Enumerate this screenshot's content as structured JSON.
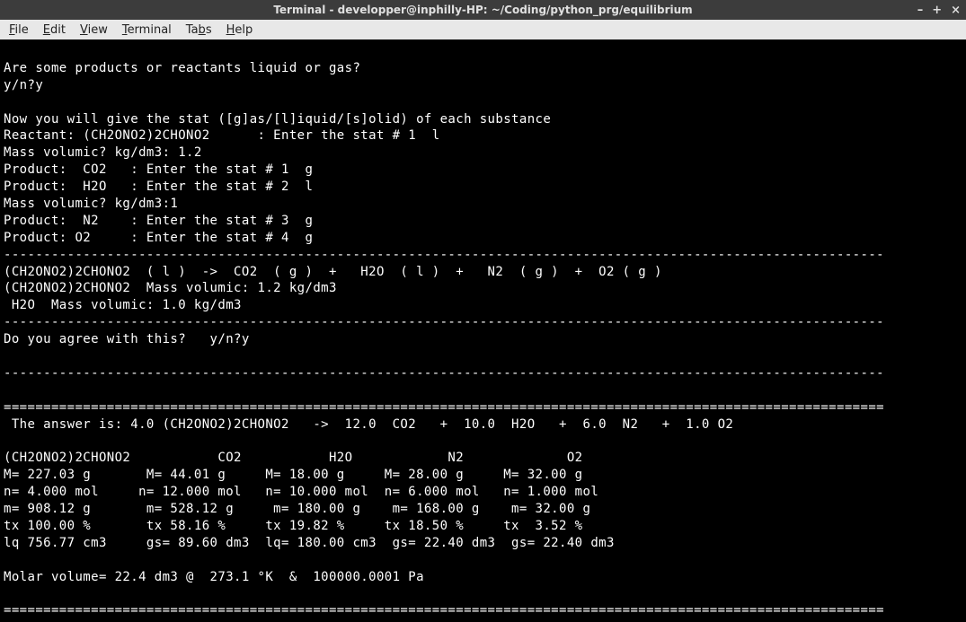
{
  "window": {
    "title": "Terminal - developper@inphilly-HP: ~/Coding/python_prg/equilibrium",
    "controls": {
      "min": "–",
      "max": "+",
      "close": "×"
    }
  },
  "menu": {
    "file": "File",
    "edit": "Edit",
    "view": "View",
    "terminal": "Terminal",
    "tabs": "Tabs",
    "help": "Help"
  },
  "lines": {
    "l01": "",
    "l02": "Are some products or reactants liquid or gas?",
    "l03": "y/n?y",
    "l04": "",
    "l05": "Now you will give the stat ([g]as/[l]iquid/[s]olid) of each substance",
    "l06": "Reactant: (CH2ONO2)2CHONO2      : Enter the stat # 1  l",
    "l07": "Mass volumic? kg/dm3: 1.2",
    "l08": "Product:  CO2   : Enter the stat # 1  g",
    "l09": "Product:  H2O   : Enter the stat # 2  l",
    "l10": "Mass volumic? kg/dm3:1",
    "l11": "Product:  N2    : Enter the stat # 3  g",
    "l12": "Product: O2     : Enter the stat # 4  g",
    "l13": "---------------------------------------------------------------------------------------------------------------",
    "l14": "(CH2ONO2)2CHONO2  ( l )  ->  CO2  ( g )  +   H2O  ( l )  +   N2  ( g )  +  O2 ( g )",
    "l15": "(CH2ONO2)2CHONO2  Mass volumic: 1.2 kg/dm3",
    "l16": " H2O  Mass volumic: 1.0 kg/dm3",
    "l17": "---------------------------------------------------------------------------------------------------------------",
    "l18": "Do you agree with this?   y/n?y",
    "l19": "",
    "l20": "---------------------------------------------------------------------------------------------------------------",
    "l21": "",
    "l22": "===============================================================================================================",
    "l23": " The answer is: 4.0 (CH2ONO2)2CHONO2   ->  12.0  CO2   +  10.0  H2O   +  6.0  N2   +  1.0 O2",
    "l24": "",
    "l25": "(CH2ONO2)2CHONO2           CO2           H2O            N2             O2",
    "l26": "M= 227.03 g       M= 44.01 g     M= 18.00 g     M= 28.00 g     M= 32.00 g",
    "l27": "n= 4.000 mol     n= 12.000 mol   n= 10.000 mol  n= 6.000 mol   n= 1.000 mol",
    "l28": "m= 908.12 g       m= 528.12 g     m= 180.00 g    m= 168.00 g    m= 32.00 g",
    "l29": "tx 100.00 %       tx 58.16 %     tx 19.82 %     tx 18.50 %     tx  3.52 %",
    "l30": "lq 756.77 cm3     gs= 89.60 dm3  lq= 180.00 cm3  gs= 22.40 dm3  gs= 22.40 dm3",
    "l31": "",
    "l32": "Molar volume= 22.4 dm3 @  273.1 °K  &  100000.0001 Pa",
    "l33": "",
    "l34": "==============================================================================================================="
  }
}
